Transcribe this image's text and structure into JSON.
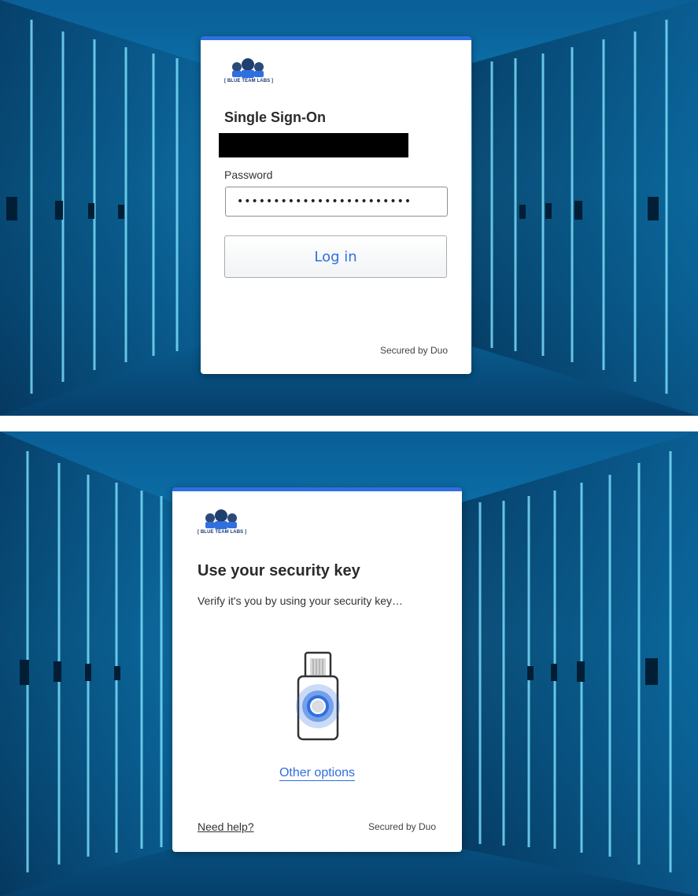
{
  "login_screen": {
    "brand": "[ BLUE TEAM LABS ]",
    "title": "Single Sign-On",
    "password_label": "Password",
    "password_value": "••••••••••••••••••••••••",
    "login_button": "Log in",
    "secured_by": "Secured by Duo"
  },
  "security_key_screen": {
    "brand": "[ BLUE TEAM LABS ]",
    "title": "Use your security key",
    "subtitle": "Verify it's you by using your security key…",
    "other_options": "Other options",
    "need_help": "Need help?",
    "secured_by": "Secured by Duo"
  },
  "icons": [
    "blue-team-labs-logo-icon",
    "security-key-icon"
  ],
  "colors": {
    "accent": "#2f6fe0",
    "background": "#0f86bf",
    "card": "#ffffff"
  }
}
